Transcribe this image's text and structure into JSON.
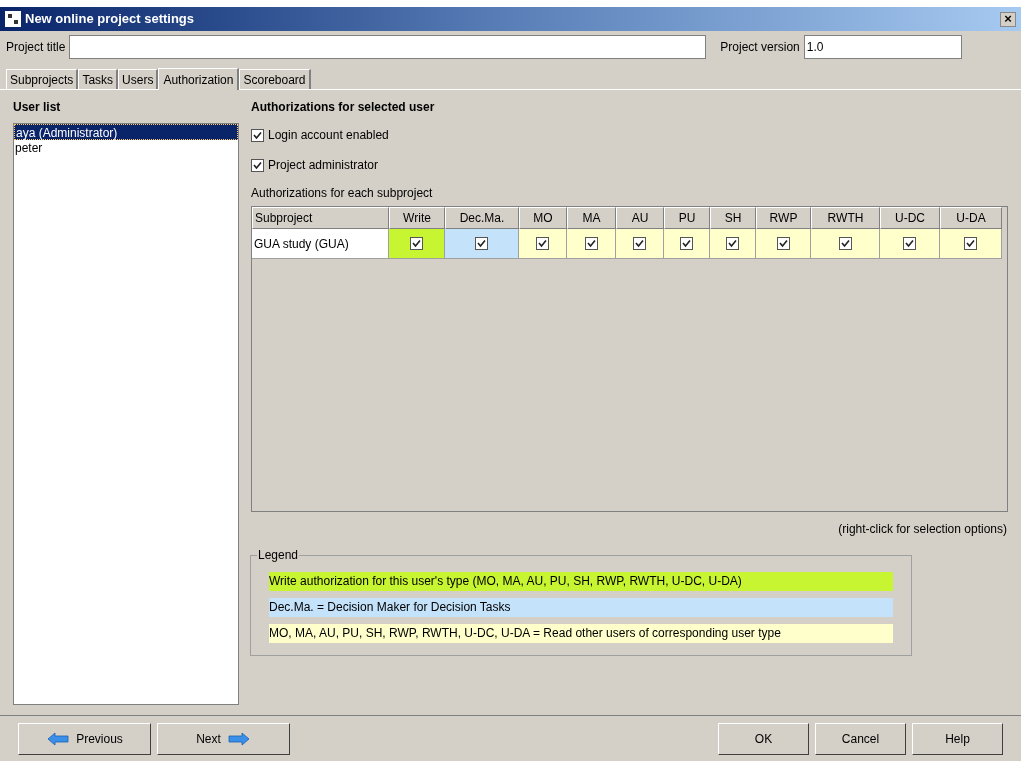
{
  "window": {
    "title": "New online project settings",
    "close": "×"
  },
  "project_title": {
    "label": "Project title"
  },
  "project_version": {
    "label": "Project version",
    "value": "1.0"
  },
  "tabs": [
    {
      "label": "Subprojects",
      "selected": false
    },
    {
      "label": "Tasks",
      "selected": false
    },
    {
      "label": "Users",
      "selected": false
    },
    {
      "label": "Authorization",
      "selected": true
    },
    {
      "label": "Scoreboard",
      "selected": false
    }
  ],
  "user_list": {
    "title": "User list",
    "items": [
      {
        "label": "aya (Administrator)",
        "selected": true
      },
      {
        "label": "peter",
        "selected": false
      }
    ]
  },
  "authorizations": {
    "title": "Authorizations for selected user",
    "options": [
      {
        "label": "Login account enabled",
        "checked": true
      },
      {
        "label": "Project administrator",
        "checked": true
      }
    ],
    "subproject_caption": "Authorizations for each subproject",
    "table": {
      "columns": [
        {
          "label": "Subproject",
          "color": "#ffffff"
        },
        {
          "label": "Write",
          "color": "#c8f531"
        },
        {
          "label": "Dec.Ma.",
          "color": "#c4e2fa"
        },
        {
          "label": "MO",
          "color": "#ffffcc"
        },
        {
          "label": "MA",
          "color": "#ffffcc"
        },
        {
          "label": "AU",
          "color": "#ffffcc"
        },
        {
          "label": "PU",
          "color": "#ffffcc"
        },
        {
          "label": "SH",
          "color": "#ffffcc"
        },
        {
          "label": "RWP",
          "color": "#ffffcc"
        },
        {
          "label": "RWTH",
          "color": "#ffffcc"
        },
        {
          "label": "U-DC",
          "color": "#ffffcc"
        },
        {
          "label": "U-DA",
          "color": "#ffffcc"
        }
      ],
      "rows": [
        {
          "name": "GUA study (GUA)",
          "checks": [
            true,
            true,
            true,
            true,
            true,
            true,
            true,
            true,
            true,
            true,
            true
          ]
        }
      ]
    },
    "hint": "(right-click for selection options)",
    "legend": {
      "title": "Legend",
      "items": [
        {
          "text": "Write authorization for this user's type (MO, MA, AU, PU, SH, RWP, RWTH, U-DC, U-DA)",
          "color": "#c8f531"
        },
        {
          "text": "Dec.Ma. = Decision Maker for Decision Tasks",
          "color": "#c4e2fa"
        },
        {
          "text": "MO, MA, AU, PU, SH, RWP, RWTH, U-DC, U-DA = Read other users of corresponding user type",
          "color": "#ffffcc"
        }
      ]
    }
  },
  "buttons_left": [
    {
      "label": "Previous",
      "kind": "back"
    },
    {
      "label": "Next",
      "kind": "forward"
    }
  ],
  "buttons_right": [
    "OK",
    "Cancel",
    "Help"
  ]
}
